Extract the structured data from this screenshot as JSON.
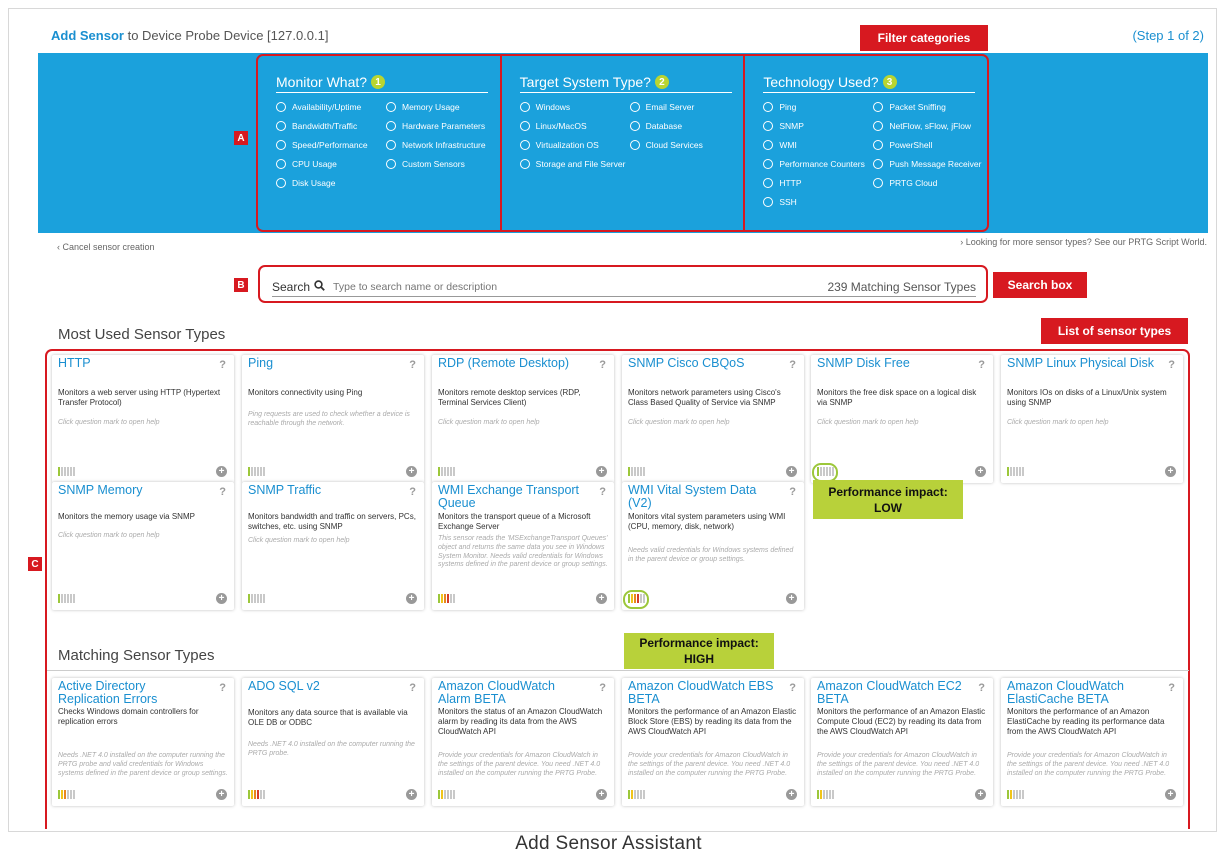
{
  "header": {
    "title_strong": "Add Sensor",
    "title_rest": " to Device Probe Device [127.0.0.1]",
    "step": "(Step 1 of 2)"
  },
  "callouts": {
    "filter": "Filter categories",
    "search": "Search box",
    "list": "List of sensor types",
    "a": "A",
    "b": "B",
    "c": "C"
  },
  "filters": [
    {
      "title": "Monitor What?",
      "num": "1",
      "options": [
        "Availability/Uptime",
        "Memory Usage",
        "Bandwidth/Traffic",
        "Hardware Parameters",
        "Speed/Performance",
        "Network Infrastructure",
        "CPU Usage",
        "Custom Sensors",
        "Disk Usage"
      ]
    },
    {
      "title": "Target System Type?",
      "num": "2",
      "options": [
        "Windows",
        "Email Server",
        "Linux/MacOS",
        "Database",
        "Virtualization OS",
        "Cloud Services",
        "Storage and File Server"
      ]
    },
    {
      "title": "Technology Used?",
      "num": "3",
      "options": [
        "Ping",
        "Packet Sniffing",
        "SNMP",
        "NetFlow, sFlow, jFlow",
        "WMI",
        "PowerShell",
        "Performance Counters",
        "Push Message Receiver",
        "HTTP",
        "PRTG Cloud",
        "SSH"
      ]
    }
  ],
  "cancel": "‹ Cancel sensor creation",
  "look_more": "› Looking for more sensor types? See our PRTG Script World.",
  "search": {
    "label": "Search",
    "placeholder": "Type to search name or description",
    "count": "239 Matching Sensor Types"
  },
  "most_used_title": "Most Used Sensor Types",
  "matching_title": "Matching Sensor Types",
  "impact_low": [
    "Performance impact:",
    "LOW"
  ],
  "impact_high": [
    "Performance impact:",
    "HIGH"
  ],
  "caption": "Add Sensor Assistant",
  "colors": {
    "accent": "#1a8fd0",
    "band": "#1ba1dc",
    "callout": "#d71920",
    "impact": "#b8d13a"
  },
  "most_used": [
    {
      "name": "HTTP",
      "desc": "Monitors a web server using HTTP (Hypertext Transfer Protocol)",
      "hint": "Click question mark to open help",
      "perf": "low1"
    },
    {
      "name": "Ping",
      "desc": "Monitors connectivity using Ping",
      "hint": "Ping requests are used to check whether a device is reachable through the network.",
      "perf": "low1"
    },
    {
      "name": "RDP (Remote Desktop)",
      "desc": "Monitors remote desktop services (RDP, Terminal Services Client)",
      "hint": "Click question mark to open help",
      "perf": "low1"
    },
    {
      "name": "SNMP Cisco CBQoS",
      "desc": "Monitors network parameters using Cisco's Class Based Quality of Service via SNMP",
      "hint": "Click question mark to open help",
      "perf": "low1"
    },
    {
      "name": "SNMP Disk Free",
      "desc": "Monitors the free disk space on a logical disk via SNMP",
      "hint": "Click question mark to open help",
      "perf": "low1"
    },
    {
      "name": "SNMP Linux Physical Disk",
      "desc": "Monitors IOs on disks of a Linux/Unix system using SNMP",
      "hint": "Click question mark to open help",
      "perf": "low1"
    },
    {
      "name": "SNMP Memory",
      "desc": "Monitors the memory usage via SNMP",
      "hint": "Click question mark to open help",
      "perf": "low1"
    },
    {
      "name": "SNMP Traffic",
      "desc": "Monitors bandwidth and traffic on servers, PCs, switches, etc. using SNMP",
      "hint": "Click question mark to open help",
      "perf": "low1"
    },
    {
      "name": "WMI Exchange Transport Queue",
      "desc": "Monitors the transport queue of a Microsoft Exchange Server",
      "hint": "This sensor reads the 'MSExchangeTransport Queues' object and returns the same data you see in Windows System Monitor. Needs valid credentials for Windows systems defined in the parent device or group settings.",
      "perf": "high"
    },
    {
      "name": "WMI Vital System Data (V2)",
      "desc": "Monitors vital system parameters using WMI (CPU, memory, disk, network)",
      "hint": "Needs valid credentials for Windows systems defined in the parent device or group settings.",
      "perf": "high"
    }
  ],
  "matching": [
    {
      "name": "Active Directory Replication Errors",
      "desc": "Checks Windows domain controllers for replication errors",
      "hint": "Needs .NET 4.0 installed on the computer running the PRTG probe and valid credentials for Windows systems defined in the parent device or group settings.",
      "perf": "mid"
    },
    {
      "name": "ADO SQL v2",
      "desc": "Monitors any data source that is available via OLE DB or ODBC",
      "hint": "Needs .NET 4.0 installed on the computer running the PRTG probe.",
      "perf": "high"
    },
    {
      "name": "Amazon CloudWatch Alarm BETA",
      "desc": "Monitors the status of an Amazon CloudWatch alarm by reading its data from the AWS CloudWatch API",
      "hint": "Provide your credentials for Amazon CloudWatch in the settings of the parent device. You need .NET 4.0 installed on the computer running the PRTG Probe.",
      "perf": "mid2"
    },
    {
      "name": "Amazon CloudWatch EBS BETA",
      "desc": "Monitors the performance of an Amazon Elastic Block Store (EBS) by reading its data from the AWS CloudWatch API",
      "hint": "Provide your credentials for Amazon CloudWatch in the settings of the parent device. You need .NET 4.0 installed on the computer running the PRTG Probe.",
      "perf": "mid2"
    },
    {
      "name": "Amazon CloudWatch EC2 BETA",
      "desc": "Monitors the performance of an Amazon Elastic Compute Cloud (EC2) by reading its data from the AWS CloudWatch API",
      "hint": "Provide your credentials for Amazon CloudWatch in the settings of the parent device. You need .NET 4.0 installed on the computer running the PRTG Probe.",
      "perf": "mid2"
    },
    {
      "name": "Amazon CloudWatch ElastiCache BETA",
      "desc": "Monitors the performance of an Amazon ElastiCache by reading its performance data from the AWS CloudWatch API",
      "hint": "Provide your credentials for Amazon CloudWatch in the settings of the parent device. You need .NET 4.0 installed on the computer running the PRTG Probe.",
      "perf": "mid2"
    }
  ]
}
